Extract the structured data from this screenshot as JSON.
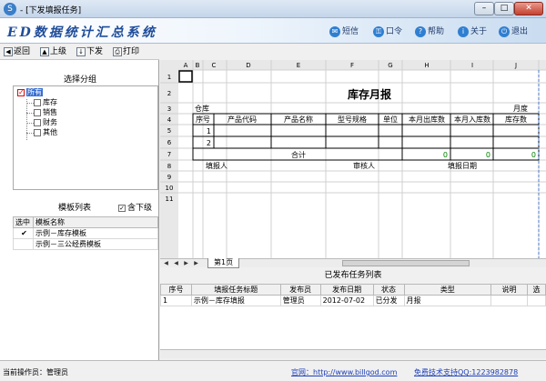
{
  "window": {
    "title": "- [下发填报任务]",
    "min": "–",
    "max": "□",
    "close": "✕"
  },
  "banner": {
    "app_title": "ED数据统计汇总系统",
    "nav": [
      {
        "label": "短信",
        "icon": "message-icon"
      },
      {
        "label": "口令",
        "icon": "key-icon"
      },
      {
        "label": "帮助",
        "icon": "help-icon"
      },
      {
        "label": "关于",
        "icon": "about-icon"
      },
      {
        "label": "退出",
        "icon": "exit-icon"
      }
    ]
  },
  "toolbar": {
    "back": "返回",
    "upper": "上级",
    "dispatch": "下发",
    "print": "打印"
  },
  "group_panel": {
    "title": "选择分组",
    "root": "所有",
    "children": [
      "库存",
      "销售",
      "财务",
      "其他"
    ]
  },
  "template_panel": {
    "title": "模板列表",
    "include_sub": "含下级",
    "columns": [
      "选中",
      "模板名称"
    ],
    "rows": [
      {
        "checked": true,
        "name": "示例－库存模板"
      },
      {
        "checked": false,
        "name": "示例－三公经费模板"
      }
    ]
  },
  "sheet": {
    "col_headers": [
      "A",
      "B",
      "C",
      "D",
      "E",
      "F",
      "G",
      "H",
      "I",
      "J"
    ],
    "row_headers": [
      "1",
      "2",
      "3",
      "4",
      "5",
      "6",
      "7",
      "8",
      "9",
      "10",
      "11"
    ],
    "title": "库存月报",
    "warehouse": "仓库",
    "month": "月度",
    "columns": [
      "序号",
      "产品代码",
      "产品名称",
      "型号规格",
      "单位",
      "本月出库数",
      "本月入库数",
      "库存数"
    ],
    "seq": [
      "1",
      "2"
    ],
    "total": "合计",
    "totals": [
      "0",
      "0",
      "0"
    ],
    "filler": "填报人",
    "reviewer": "审核人",
    "fill_date": "填报日期",
    "tab": "第1页"
  },
  "published": {
    "title": "已发布任务列表",
    "columns": [
      "序号",
      "填报任务标题",
      "发布员",
      "发布日期",
      "状态",
      "类型",
      "说明",
      "选"
    ],
    "rows": [
      [
        "1",
        "示例－库存填报",
        "管理员",
        "2012-07-02",
        "已分发",
        "月报",
        "",
        ""
      ]
    ]
  },
  "status": {
    "operator": "当前操作员：管理员",
    "website": "官网：http://www.billgod.com",
    "support": "免费技术支持QQ:1223982878"
  },
  "colors": {
    "accent": "#1f4d9a",
    "selection": "#3a6fd0",
    "total": "#008000",
    "link": "#1c3fb8"
  }
}
